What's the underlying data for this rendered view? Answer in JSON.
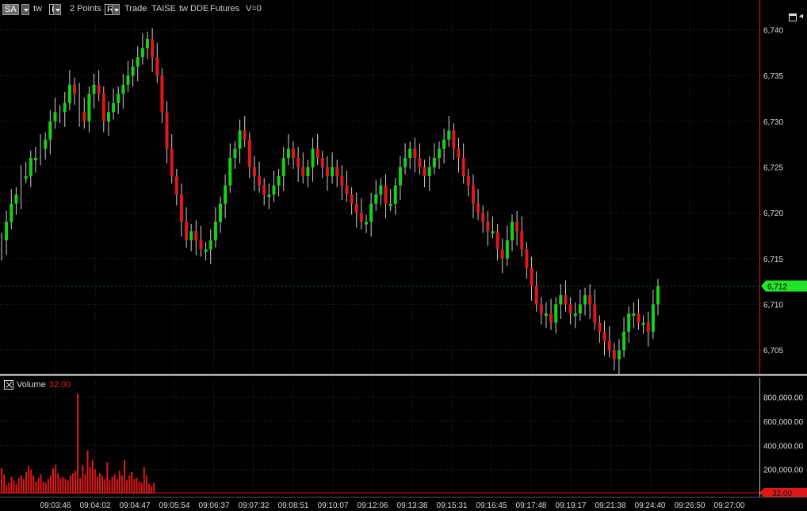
{
  "toolbar": {
    "symbol": "SA",
    "feed": "tw",
    "interval_box": "I",
    "points": "2 Points",
    "r_box": "R",
    "items": [
      "Trade",
      "TAISE",
      "tw DDE",
      "Futures",
      "V=0"
    ]
  },
  "colors": {
    "up": "#12d412",
    "down": "#e01818",
    "grid": "#2a2a2a",
    "separator": "#c82020",
    "last_badge": "#22e22a",
    "volume": "#e01818"
  },
  "chart_data": [
    {
      "type": "candlestick",
      "title": "",
      "ylim": [
        6702.5,
        6743
      ],
      "yticks": [
        6705,
        6710,
        6715,
        6720,
        6725,
        6730,
        6735,
        6740
      ],
      "ytick_labels": [
        "6,705",
        "6,710",
        "6,715",
        "6,720",
        "6,725",
        "6,730",
        "6,735",
        "6,740"
      ],
      "last_price": 6712,
      "last_price_label": "6,712",
      "bar_count": 136,
      "closes": [
        6717,
        6719,
        6721,
        6722,
        6724,
        6724,
        6726,
        6726,
        6727,
        6728,
        6730,
        6731,
        6731,
        6732,
        6734,
        6733,
        6731,
        6730,
        6733,
        6734,
        6733,
        6730,
        6731,
        6732,
        6733,
        6734,
        6735,
        6736,
        6737,
        6738,
        6739,
        6737,
        6735,
        6731,
        6727,
        6724,
        6722,
        6719,
        6717,
        6718,
        6717,
        6716,
        6716,
        6717,
        6719,
        6721,
        6723,
        6726,
        6727,
        6729,
        6728,
        6725,
        6724,
        6723,
        6722,
        6722,
        6723,
        6724,
        6726,
        6727,
        6726,
        6725,
        6724,
        6725,
        6727,
        6726,
        6725,
        6724,
        6725,
        6724,
        6723,
        6722,
        6721,
        6720,
        6719,
        6719,
        6721,
        6722,
        6723,
        6721,
        6721,
        6723,
        6725,
        6726,
        6727,
        6726,
        6725,
        6724,
        6725,
        6726,
        6727,
        6728,
        6729,
        6727,
        6726,
        6724,
        6723,
        6721,
        6720,
        6719,
        6718,
        6718,
        6716,
        6715,
        6717,
        6719,
        6718,
        6716,
        6714,
        6712,
        6710,
        6709,
        6709,
        6708,
        6710,
        6711,
        6710,
        6709,
        6709,
        6710,
        6711,
        6710,
        6708,
        6707,
        6706,
        6705,
        6704,
        6705,
        6707,
        6709,
        6709,
        6708,
        6708,
        6707,
        6710,
        6712
      ],
      "bars_shown_as_candles": 118
    },
    {
      "type": "bar",
      "title": "Volume",
      "value_label": "32.00",
      "ylim": [
        0,
        950000
      ],
      "yticks": [
        200000,
        400000,
        600000,
        800000
      ],
      "ytick_labels": [
        "200,000.00",
        "400,000.00",
        "600,000.00",
        "800,000.00"
      ],
      "values": [
        210000,
        160000,
        70000,
        90000,
        140000,
        110000,
        80000,
        130000,
        150000,
        120000,
        180000,
        230000,
        200000,
        150000,
        100000,
        130000,
        160000,
        100000,
        90000,
        120000,
        150000,
        210000,
        240000,
        170000,
        130000,
        140000,
        120000,
        110000,
        150000,
        170000,
        190000,
        830000,
        130000,
        240000,
        160000,
        360000,
        220000,
        280000,
        200000,
        140000,
        170000,
        150000,
        120000,
        260000,
        110000,
        140000,
        160000,
        120000,
        190000,
        150000,
        280000,
        110000,
        150000,
        180000,
        120000,
        130000,
        100000,
        90000,
        220000,
        150000,
        80000,
        60000,
        90000
      ],
      "x_tick_labels": [
        "09:03:46",
        "09:04:02",
        "09:04:47",
        "09:05:54",
        "09:06:37",
        "09:07:32",
        "09:08:51",
        "09:10:07",
        "09:12:06",
        "09:13:38",
        "09:15:31",
        "09:16:45",
        "09:17:48",
        "09:19:17",
        "09:21:38",
        "09:24:40",
        "09:26:50",
        "09:27:00"
      ]
    }
  ]
}
